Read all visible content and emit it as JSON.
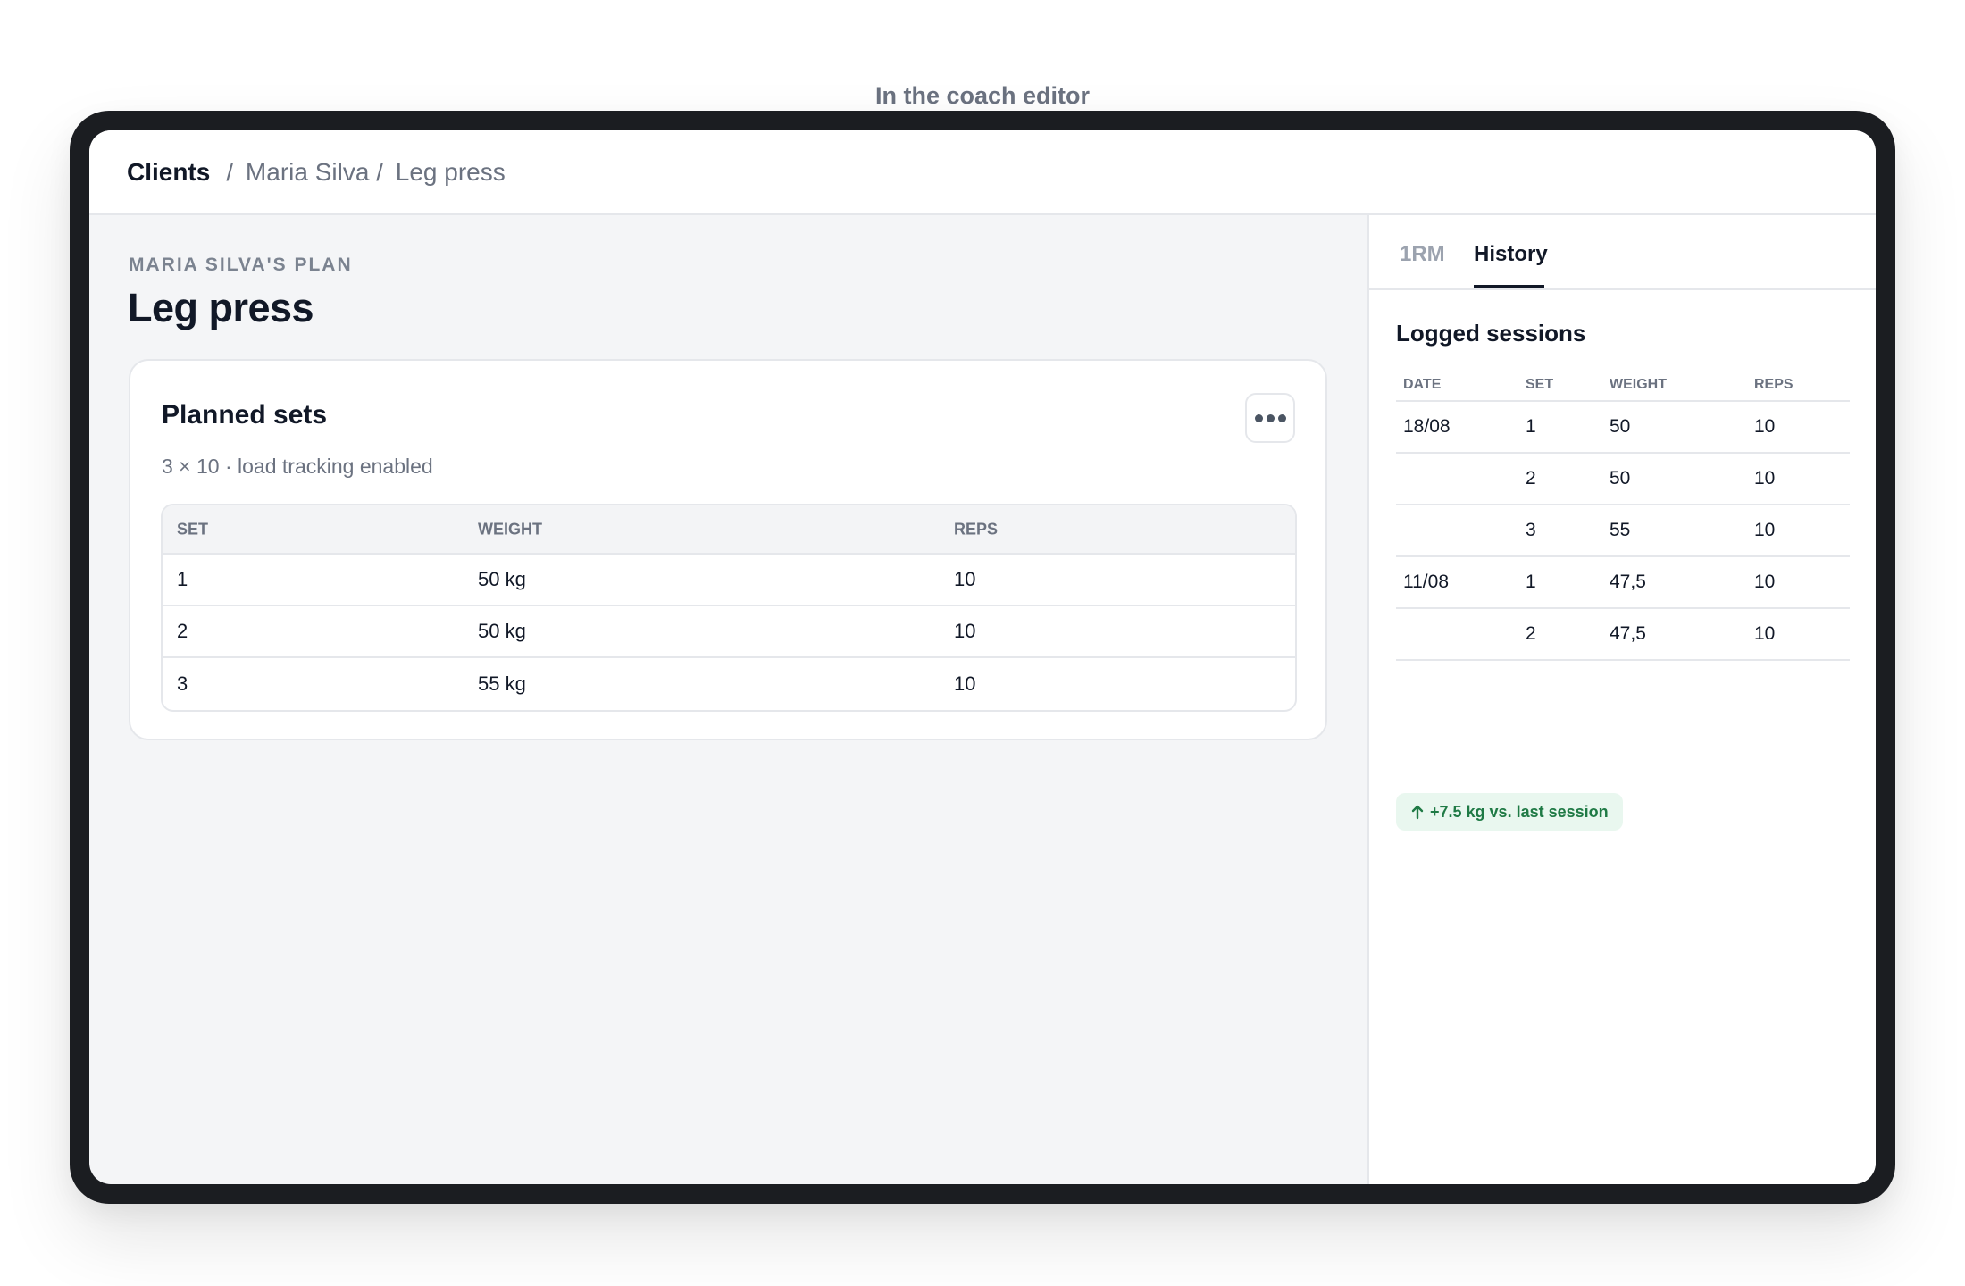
{
  "caption": "In the coach editor",
  "breadcrumb": {
    "root": "Clients",
    "client": "Maria Silva",
    "exercise": "Leg press",
    "separator": "/"
  },
  "plan": {
    "eyebrow": "MARIA SILVA'S PLAN",
    "title": "Leg press"
  },
  "planned_sets": {
    "title": "Planned sets",
    "subtitle": "3 × 10 · load tracking enabled",
    "more_icon": "more-horizontal-icon",
    "columns": [
      "SET",
      "WEIGHT",
      "REPS"
    ],
    "rows": [
      {
        "set": "1",
        "weight": "50 kg",
        "reps": "10"
      },
      {
        "set": "2",
        "weight": "50 kg",
        "reps": "10"
      },
      {
        "set": "3",
        "weight": "55 kg",
        "reps": "10"
      }
    ]
  },
  "side_panel": {
    "tabs": [
      {
        "label": "1RM",
        "active": false
      },
      {
        "label": "History",
        "active": true
      }
    ],
    "title": "Logged sessions",
    "columns": [
      "DATE",
      "SET",
      "WEIGHT",
      "REPS"
    ],
    "rows": [
      {
        "date": "18/08",
        "set": "1",
        "weight": "50",
        "reps": "10"
      },
      {
        "date": "",
        "set": "2",
        "weight": "50",
        "reps": "10"
      },
      {
        "date": "",
        "set": "3",
        "weight": "55",
        "reps": "10"
      },
      {
        "date": "11/08",
        "set": "1",
        "weight": "47,5",
        "reps": "10"
      },
      {
        "date": "",
        "set": "2",
        "weight": "47,5",
        "reps": "10"
      }
    ],
    "badge": {
      "icon": "arrow-up-icon",
      "text": "+7.5 kg vs. last session",
      "color": "#1f7a45"
    }
  }
}
